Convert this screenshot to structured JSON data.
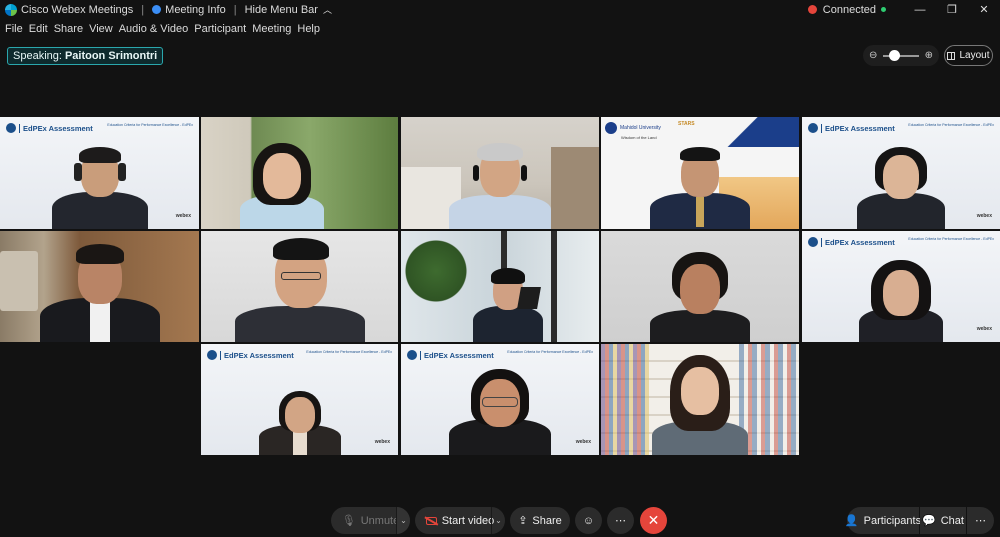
{
  "titlebar": {
    "app_name": "Cisco Webex Meetings",
    "meeting_info": "Meeting Info",
    "hide_menu": "Hide Menu Bar",
    "status": "Connected",
    "minimize": "—",
    "restore": "❐",
    "close": "✕"
  },
  "menu": [
    "File",
    "Edit",
    "Share",
    "View",
    "Audio & Video",
    "Participant",
    "Meeting",
    "Help"
  ],
  "speaking": {
    "label": "Speaking:",
    "name": "Paitoon Srimontri"
  },
  "layout_label": "Layout",
  "edpex": {
    "title": "EdPEx Assessment",
    "subtitle": "Education Criteria for Performance Excellence - EdPEx",
    "webex": "webex"
  },
  "mahidol": {
    "logo_text": "Mahidol University",
    "tagline": "Wisdom of the Land",
    "stars": "STARS"
  },
  "controls": {
    "unmute": "Unmute",
    "start_video": "Start video",
    "share": "Share",
    "participants": "Participants",
    "chat": "Chat"
  },
  "colors": {
    "accent_teal": "#2aa7ad",
    "leave_red": "#e5453b",
    "edpex_blue": "#1b4f8a"
  }
}
